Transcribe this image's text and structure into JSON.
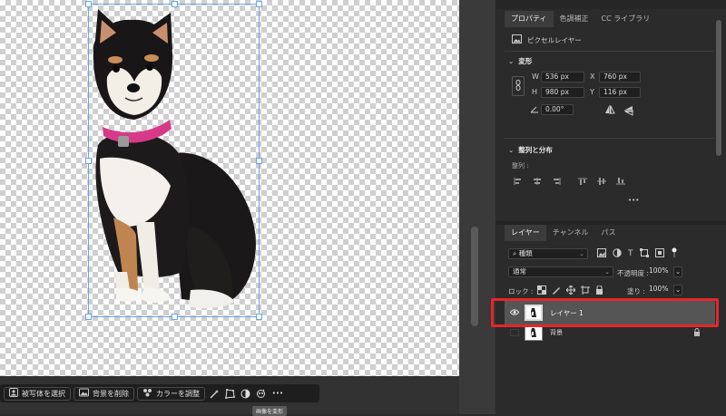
{
  "taskbar": {
    "select_subject": "被写体を選択",
    "remove_bg": "背景を削除",
    "adjust_color": "カラーを調整",
    "more": "•••"
  },
  "tooltip": "画像を変形",
  "properties": {
    "tabs": [
      "プロパティ",
      "色調補正",
      "CC ライブラリ"
    ],
    "layer_type": "ピクセルレイヤー",
    "transform_title": "変形",
    "w_label": "W",
    "w_value": "536 px",
    "x_label": "X",
    "x_value": "760 px",
    "h_label": "H",
    "h_value": "980 px",
    "y_label": "Y",
    "y_value": "116 px",
    "angle_value": "0.00°",
    "align_title": "整列と分布",
    "align_label": "整列 :",
    "more": "•••"
  },
  "layers_panel": {
    "tabs": [
      "レイヤー",
      "チャンネル",
      "パス"
    ],
    "filter_kind": "種類",
    "blend_mode": "通常",
    "opacity_label": "不透明度 :",
    "opacity_value": "100%",
    "lock_label": "ロック :",
    "fill_label": "塗り :",
    "fill_value": "100%",
    "layers": [
      {
        "name": "レイヤー 1",
        "selected": true,
        "visible": true
      },
      {
        "name": "背景",
        "selected": false,
        "visible": false,
        "locked": true
      }
    ]
  },
  "colors": {
    "highlight": "#e5262a",
    "selection": "#6aa4e8",
    "panel_bg": "#2b2b2b"
  }
}
